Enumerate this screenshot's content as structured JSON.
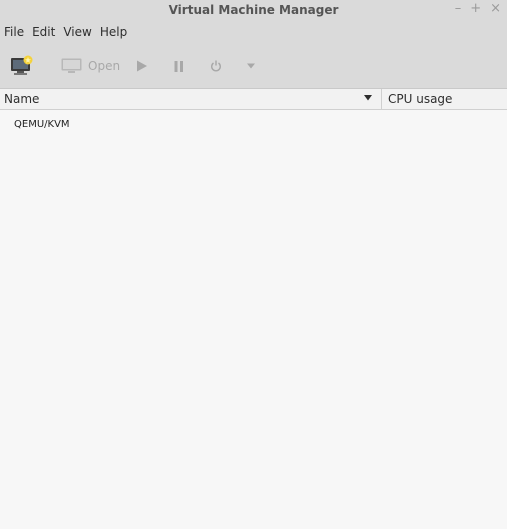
{
  "window": {
    "title": "Virtual Machine Manager",
    "controls": [
      "–",
      "+",
      "×"
    ]
  },
  "menubar": {
    "items": [
      "File",
      "Edit",
      "View",
      "Help"
    ]
  },
  "toolbar": {
    "open_label": "Open",
    "icons": [
      "new-vm-icon",
      "console-monitor-icon",
      "play-icon",
      "pause-icon",
      "power-icon",
      "dropdown-arrow-icon"
    ]
  },
  "table": {
    "columns": [
      "Name",
      "CPU usage"
    ],
    "rows": [
      {
        "name": "QEMU/KVM"
      }
    ]
  },
  "colors": {
    "chrome": "#dadada",
    "content": "#f7f7f7",
    "disabled": "#a8a8a8",
    "text": "#2e2e2e"
  }
}
